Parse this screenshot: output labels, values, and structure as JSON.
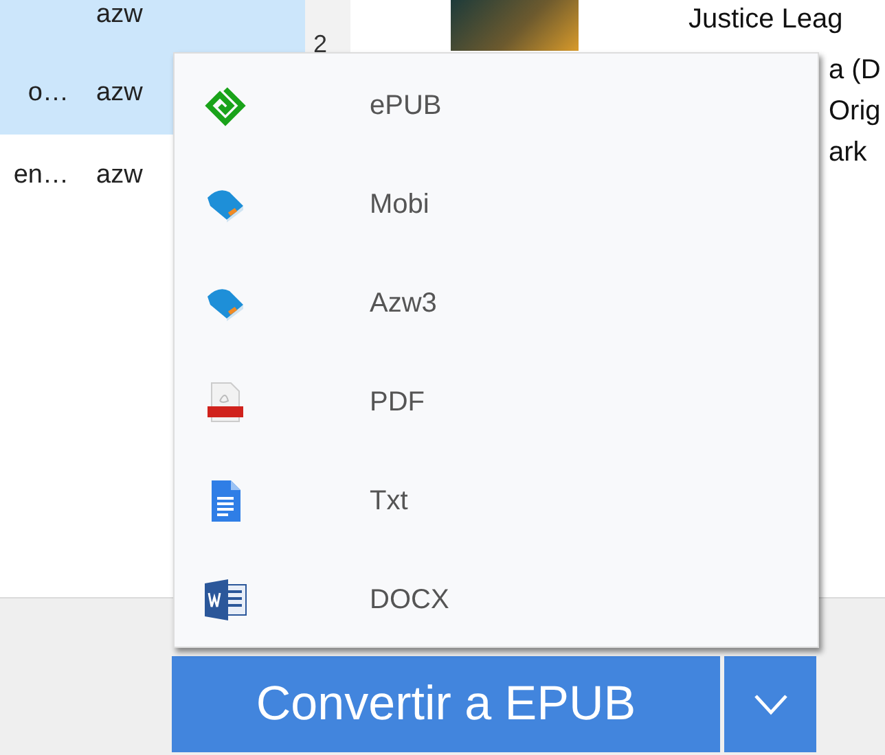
{
  "book_list": {
    "rows": [
      {
        "format": "azw",
        "selected": true
      },
      {
        "title": "o…",
        "format": "azw",
        "selected": true
      },
      {
        "title": "en…",
        "format": "azw",
        "selected": false
      }
    ],
    "count": "2"
  },
  "book_details": {
    "title_lines": [
      "Justice Leag"
    ],
    "title_lines_visible_past_menu": [
      "a (D",
      "Orig",
      "ark"
    ]
  },
  "format_menu": {
    "items": [
      {
        "label": "ePUB",
        "kind": "epub"
      },
      {
        "label": "Mobi",
        "kind": "book"
      },
      {
        "label": "Azw3",
        "kind": "book"
      },
      {
        "label": "PDF",
        "kind": "pdf"
      },
      {
        "label": "Txt",
        "kind": "doc"
      },
      {
        "label": "DOCX",
        "kind": "word"
      }
    ]
  },
  "convert_button": {
    "label": "Convertir a EPUB"
  }
}
